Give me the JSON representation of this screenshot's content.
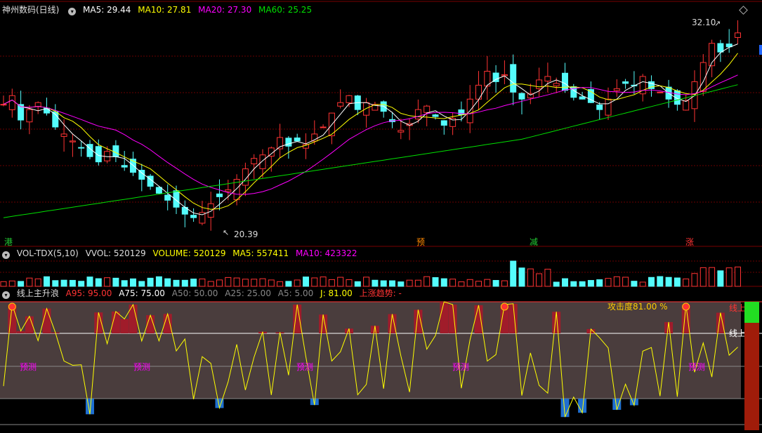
{
  "main": {
    "title": "神州数码(日线)",
    "ma5": "MA5: 29.44",
    "ma10": "MA10: 27.81",
    "ma20": "MA20: 27.30",
    "ma60": "MA60: 25.25",
    "price_high": "32.10",
    "price_low": "20.39",
    "signals": [
      {
        "label": "港",
        "color": "#22cc33"
      },
      {
        "label": "预",
        "color": "#ff8800"
      },
      {
        "label": "减",
        "color": "#22cc33"
      },
      {
        "label": "涨",
        "color": "#ff3333"
      }
    ]
  },
  "volume": {
    "title": "VOL-TDX(5,10)",
    "vvol": "VVOL: 520129",
    "volume": "VOLUME: 520129",
    "ma5": "MA5: 557411",
    "ma10": "MA10: 423322"
  },
  "indicator": {
    "title": "线上主升浪",
    "a95": "A95: 95.00",
    "a75": "A75: 75.00",
    "a50": "A50: 50.00",
    "a25": "A25: 25.00",
    "a5": "A5: 5.00",
    "j": "J: 81.00",
    "trend": "上涨趋势: -",
    "attack": "攻击度81.00 %",
    "predict": "预测",
    "line_top": "线上",
    "line_mid": "线上"
  },
  "colors": {
    "up": "#ff3333",
    "down": "#54fcfc",
    "ma5": "#ffffff",
    "ma10": "#ffff00",
    "ma20": "#ff00ff",
    "ma60": "#00e000"
  }
}
